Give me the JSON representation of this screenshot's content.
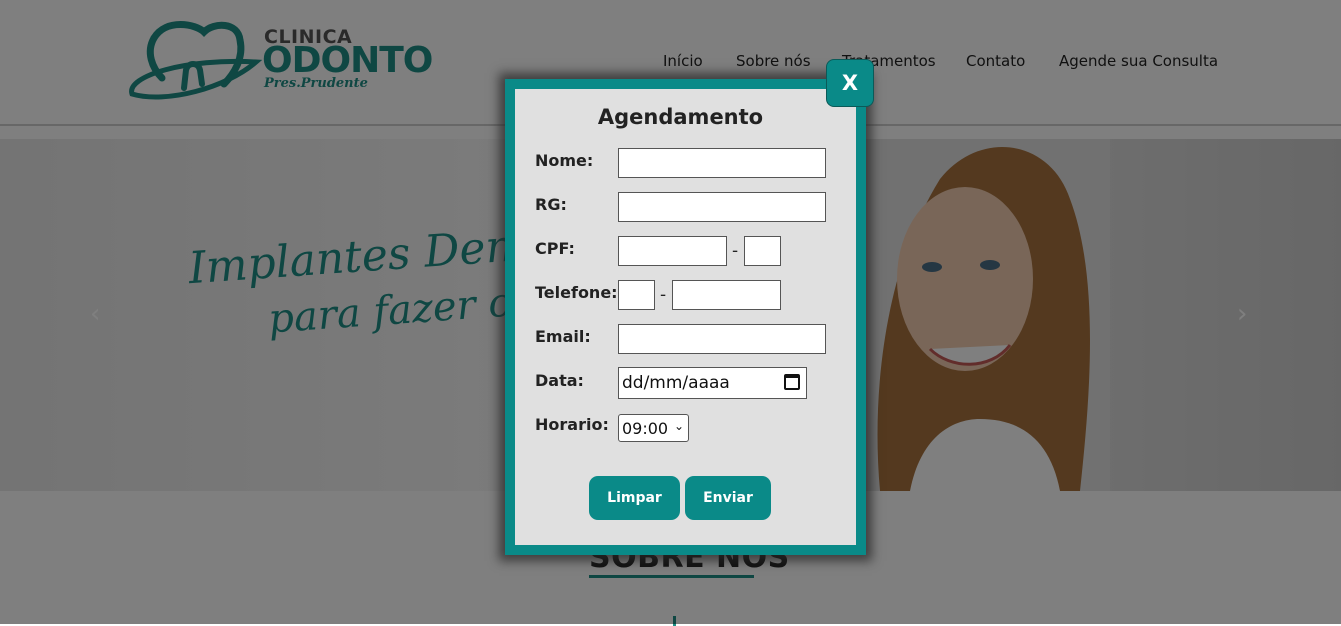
{
  "header": {
    "logo": {
      "line1": "CLINICA",
      "line2": "ODONTO",
      "line3": "Pres.Prudente"
    },
    "nav": [
      "Início",
      "Sobre nós",
      "Tratamentos",
      "Contato",
      "Agende sua Consulta"
    ]
  },
  "hero": {
    "line1": "Implantes Dentários,",
    "line2": "para fazer o que",
    "prev_icon": "chevron-left-icon",
    "next_icon": "chevron-right-icon"
  },
  "about": {
    "title": "SOBRE NÓS"
  },
  "modal": {
    "title": "Agendamento",
    "close_label": "X",
    "fields": {
      "nome": {
        "label": "Nome:",
        "value": ""
      },
      "rg": {
        "label": "RG:",
        "value": ""
      },
      "cpf": {
        "label": "CPF:",
        "value": "",
        "digit": "",
        "separator": "-"
      },
      "telefone": {
        "label": "Telefone:",
        "ddd": "",
        "number": "",
        "separator": "-"
      },
      "email": {
        "label": "Email:",
        "value": ""
      },
      "data": {
        "label": "Data:",
        "placeholder": "dd/mm/aaaa"
      },
      "horario": {
        "label": "Horario:",
        "selected": "09:00"
      }
    },
    "buttons": {
      "clear": "Limpar",
      "submit": "Enviar"
    }
  },
  "colors": {
    "accent": "#0a8a88",
    "overlay": "rgba(0,0,0,0.5)"
  }
}
